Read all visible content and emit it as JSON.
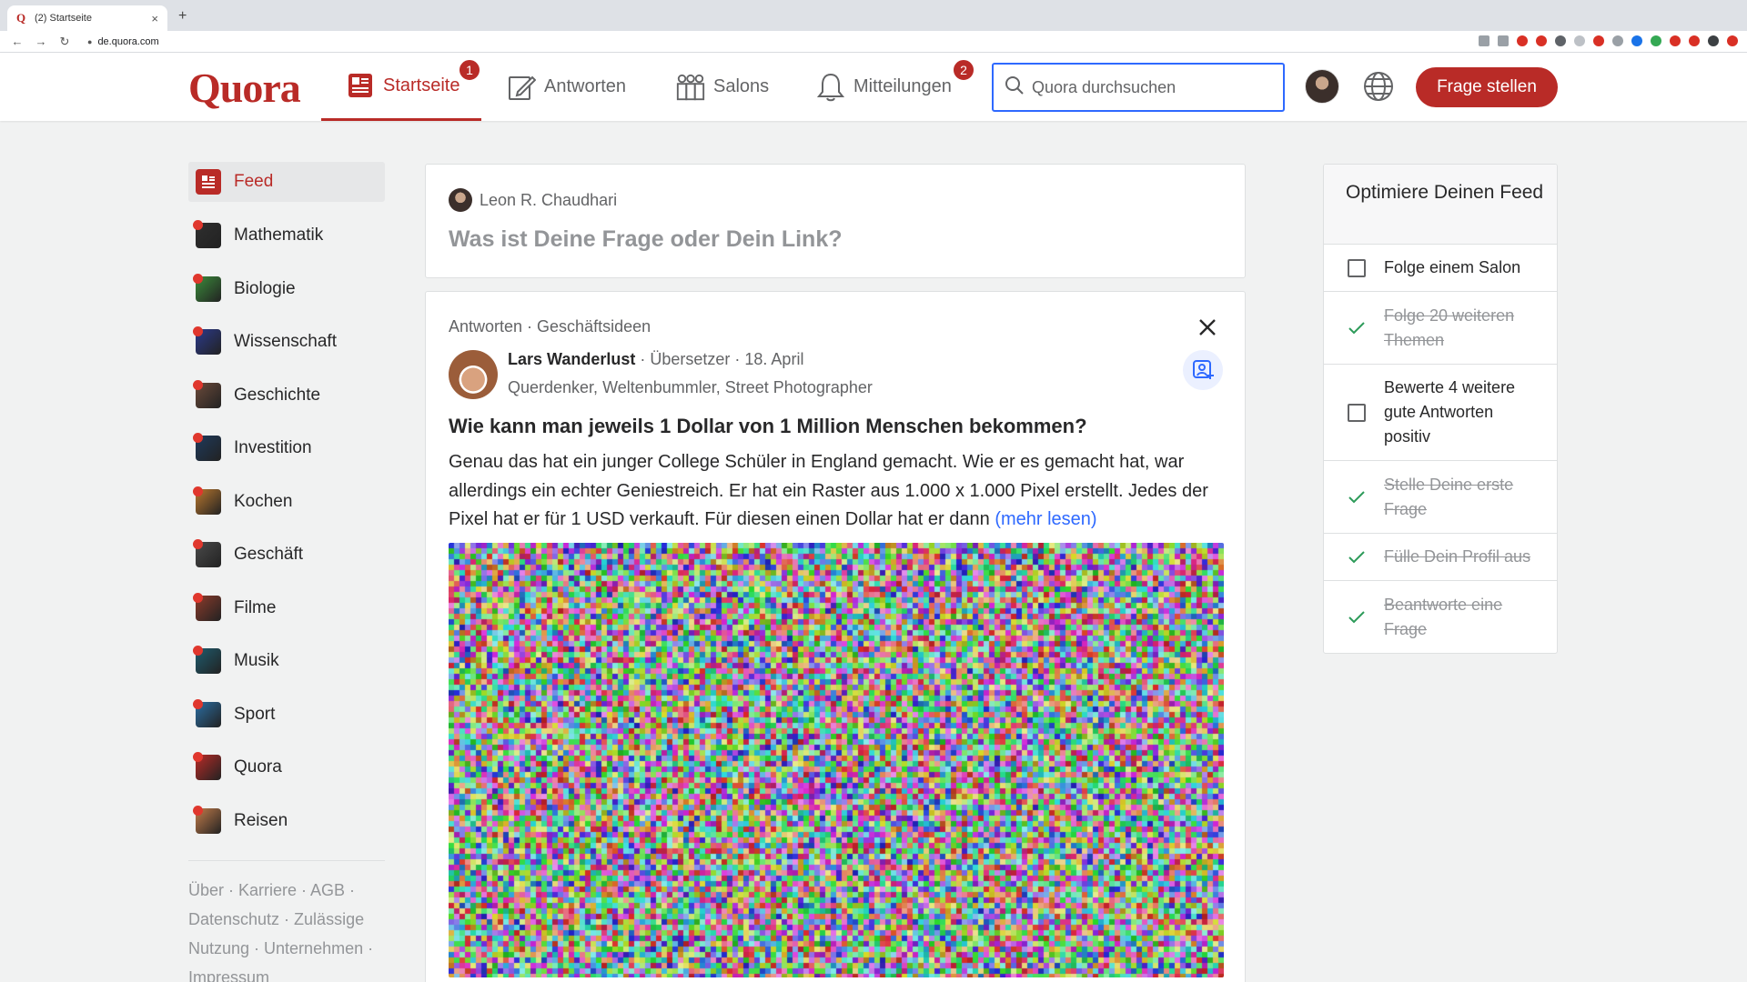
{
  "browser": {
    "tab_title": "(2) Startseite",
    "tab_favicon": "Q",
    "tab_close": "×",
    "new_tab": "+",
    "url": "de.quora.com",
    "back": "←",
    "forward": "→",
    "reload": "↻",
    "extension_colors": [
      "#9aa0a6",
      "#9aa0a6",
      "#d93025",
      "#d93025",
      "#5f6368",
      "#bdc1c6",
      "#d93025",
      "#9aa0a6",
      "#1a73e8",
      "#34a853",
      "#d93025",
      "#d93025",
      "#3c4043",
      "#d93025"
    ]
  },
  "header": {
    "logo": "Quora",
    "nav": [
      {
        "label": "Startseite",
        "icon": "home-feed-icon",
        "badge": "1",
        "active": true
      },
      {
        "label": "Antworten",
        "icon": "pencil-icon",
        "badge": "",
        "active": false
      },
      {
        "label": "Salons",
        "icon": "people-icon",
        "badge": "",
        "active": false
      },
      {
        "label": "Mitteilungen",
        "icon": "bell-icon",
        "badge": "2",
        "active": false
      }
    ],
    "search_placeholder": "Quora durchsuchen",
    "ask_button": "Frage stellen",
    "accent": "#b92b27"
  },
  "sidebar": {
    "items": [
      {
        "label": "Feed",
        "color": "#b92b27"
      },
      {
        "label": "Mathematik",
        "color": "#2f2f2f"
      },
      {
        "label": "Biologie",
        "color": "#3b8c3b"
      },
      {
        "label": "Wissenschaft",
        "color": "#2b3a8c"
      },
      {
        "label": "Geschichte",
        "color": "#6b4a3a"
      },
      {
        "label": "Investition",
        "color": "#1e3a5c"
      },
      {
        "label": "Kochen",
        "color": "#b9772e"
      },
      {
        "label": "Geschäft",
        "color": "#4a4a4a"
      },
      {
        "label": "Filme",
        "color": "#8c3b2b"
      },
      {
        "label": "Musik",
        "color": "#1e5c6e"
      },
      {
        "label": "Sport",
        "color": "#2b6ea3"
      },
      {
        "label": "Quora",
        "color": "#b92b27"
      },
      {
        "label": "Reisen",
        "color": "#c27c4a"
      }
    ],
    "footer": "Über · Karriere · AGB · Datenschutz · Zulässige Nutzung · Unternehmen · Impressum"
  },
  "ask_box": {
    "user": "Leon R. Chaudhari",
    "prompt": "Was ist Deine Frage oder Dein Link?"
  },
  "post": {
    "context": "Antworten · Geschäftsideen",
    "author": "Lars Wanderlust",
    "meta": " · Übersetzer · 18. April",
    "credential": "Querdenker, Weltenbummler, Street Photographer",
    "title": "Wie kann man jeweils 1 Dollar von 1 Million Menschen bekommen?",
    "body": "Genau das hat ein junger College Schüler in England gemacht. Wie er es gemacht hat, war allerdings ein echter Geniestreich. Er hat ein Raster aus 1.000 x 1.000 Pixel erstellt. Jedes der Pixel hat er für 1 USD verkauft. Für diesen einen Dollar hat er dann ",
    "more": "(mehr lesen)"
  },
  "optimize": {
    "title": "Optimiere Deinen Feed",
    "items": [
      {
        "label": "Folge einem Salon",
        "done": false
      },
      {
        "label": "Folge 20 weiteren Themen",
        "done": true
      },
      {
        "label": "Bewerte 4 weitere gute Antworten positiv",
        "done": false
      },
      {
        "label": "Stelle Deine erste Frage",
        "done": true
      },
      {
        "label": "Fülle Dein Profil aus",
        "done": true
      },
      {
        "label": "Beantworte eine Frage",
        "done": true
      }
    ]
  }
}
